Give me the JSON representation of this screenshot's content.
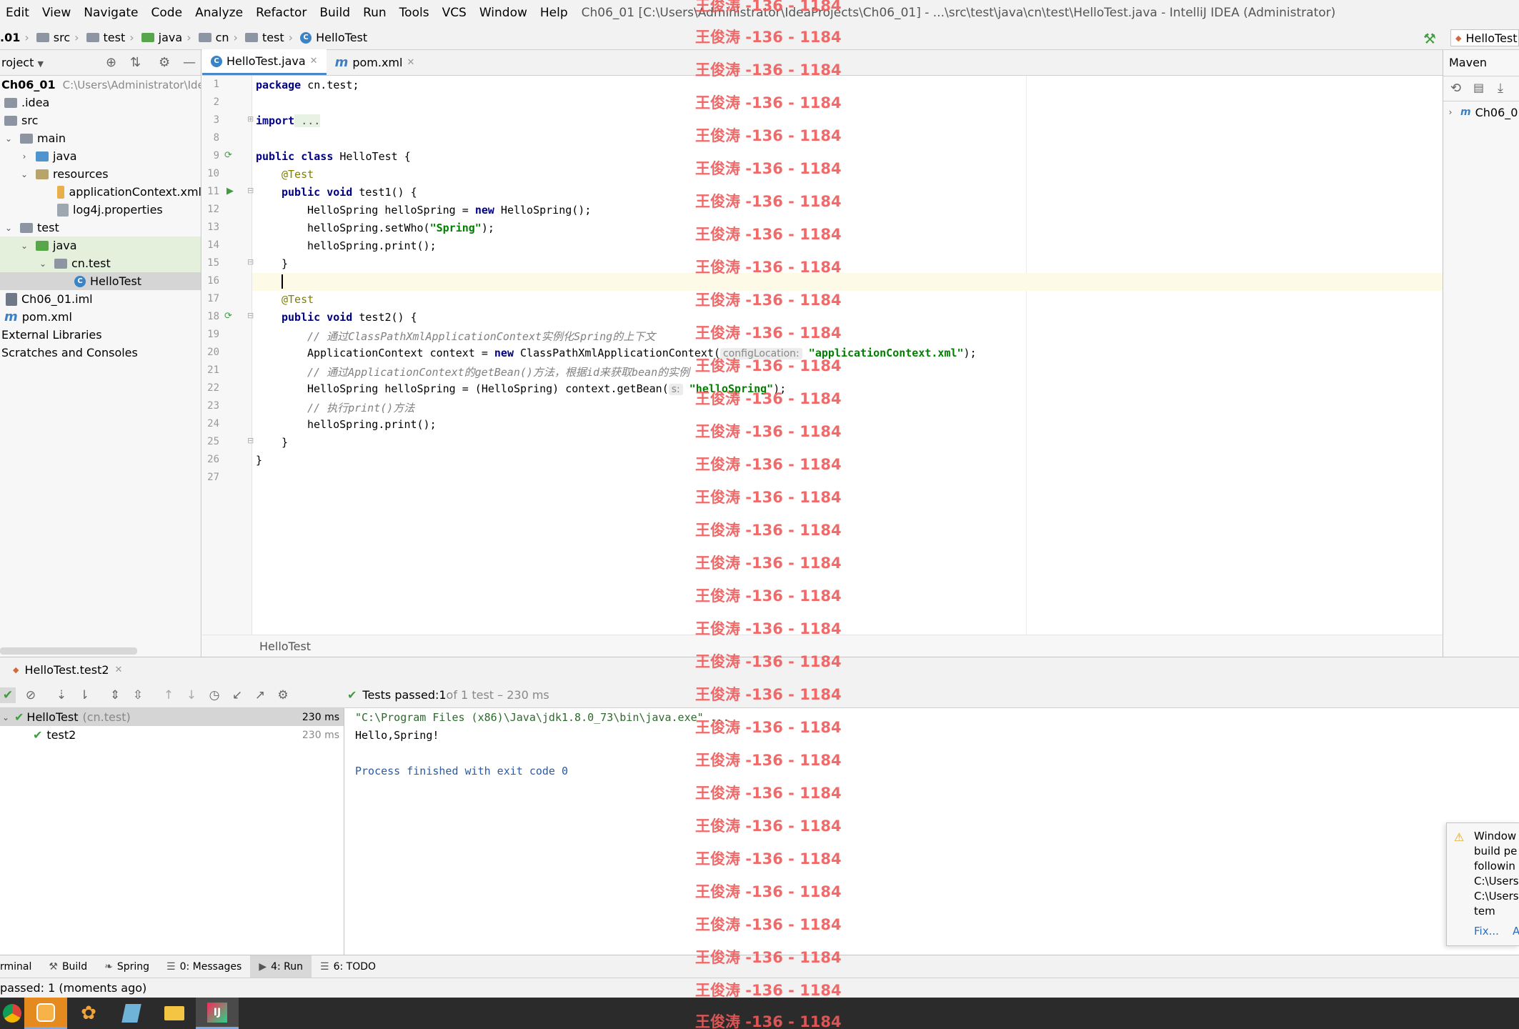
{
  "menu": {
    "items": [
      "Edit",
      "View",
      "Navigate",
      "Code",
      "Analyze",
      "Refactor",
      "Build",
      "Run",
      "Tools",
      "VCS",
      "Window",
      "Help"
    ],
    "window_title": "Ch06_01 [C:\\Users\\Administrator\\IdeaProjects\\Ch06_01] - ...\\src\\test\\java\\cn\\test\\HelloTest.java - IntelliJ IDEA (Administrator)"
  },
  "nav": {
    "crumbs": [
      ".01",
      "src",
      "test",
      "java",
      "cn",
      "test",
      "HelloTest"
    ],
    "run_config": "HelloTest"
  },
  "project": {
    "header": "roject",
    "root_name": "Ch06_01",
    "root_path": "C:\\Users\\Administrator\\IdeaP",
    "items": [
      ".idea",
      "src",
      "main",
      "java",
      "resources",
      "applicationContext.xml",
      "log4j.properties",
      "test",
      "java",
      "cn.test",
      "HelloTest",
      "Ch06_01.iml",
      "pom.xml",
      "External Libraries",
      "Scratches and Consoles"
    ]
  },
  "editor": {
    "tabs": [
      "HelloTest.java",
      "pom.xml"
    ],
    "line_numbers": [
      "1",
      "2",
      "3",
      "8",
      "9",
      "10",
      "11",
      "12",
      "13",
      "14",
      "15",
      "16",
      "17",
      "18",
      "19",
      "20",
      "21",
      "22",
      "23",
      "24",
      "25",
      "26",
      "27"
    ],
    "code": {
      "l1_kw": "package",
      "l1_rest": " cn.test;",
      "l3_kw": "import",
      "l3_fold": " ...",
      "l9_kw": "public class",
      "l9_rest": " HelloTest {",
      "ann_test": "@Test",
      "l11_kw": "public void",
      "l11_rest": " test1() {",
      "l12_a": "HelloSpring helloSpring = ",
      "l12_kw": "new",
      "l12_b": " HelloSpring();",
      "l13_a": "helloSpring.setWho(",
      "l13_str": "\"Spring\"",
      "l13_b": ");",
      "l14": "helloSpring.print();",
      "close_brace": "}",
      "l18_kw": "public void",
      "l18_rest": " test2() {",
      "l19_cmt": "// 通过ClassPathXmlApplicationContext实例化Spring的上下文",
      "l20_a": "ApplicationContext context = ",
      "l20_kw": "new",
      "l20_b": " ClassPathXmlApplicationContext(",
      "l20_hint": "configLocation:",
      "l20_str": "\"applicationContext.xml\"",
      "l20_c": ");",
      "l21_cmt": "// 通过ApplicationContext的getBean()方法，根据id来获取bean的实例",
      "l22_a": "HelloSpring helloSpring = (HelloSpring) context.getBean(",
      "l22_hint": "s:",
      "l22_str": "\"helloSpring\"",
      "l22_b": ");",
      "l23_cmt": "// 执行print()方法",
      "l24": "helloSpring.print();"
    },
    "bottom_breadcrumb": "HelloTest"
  },
  "maven": {
    "title": "Maven",
    "project": "Ch06_0"
  },
  "run": {
    "tab": "HelloTest.test2",
    "status_prefix": "Tests passed: ",
    "status_count": "1",
    "status_suffix": " of 1 test – 230 ms",
    "tree": [
      {
        "name": "HelloTest",
        "pkg": "(cn.test)",
        "time": "230 ms"
      },
      {
        "name": "test2",
        "pkg": "",
        "time": "230 ms"
      }
    ],
    "console": [
      "\"C:\\Program Files (x86)\\Java\\jdk1.8.0_73\\bin\\java.exe\" ...",
      "Hello,Spring!",
      "",
      "Process finished with exit code 0"
    ]
  },
  "toolstrip": {
    "tabs": [
      "rminal",
      "Build",
      "Spring",
      "0: Messages",
      "4: Run",
      "6: TODO"
    ]
  },
  "status_bar": "passed: 1 (moments ago)",
  "notification": {
    "lines": [
      "Window",
      "build pe",
      "followin",
      "C:\\Users",
      "C:\\Users",
      "tem"
    ],
    "action1": "Fix...",
    "action2": "A"
  },
  "watermark": "王俊涛 -136 - 1184",
  "colors": {
    "keyword": "#000080",
    "string": "#008000",
    "annotation": "#808000",
    "comment": "#808080",
    "success": "#3e9e3e",
    "watermark": "#f05a5a"
  }
}
